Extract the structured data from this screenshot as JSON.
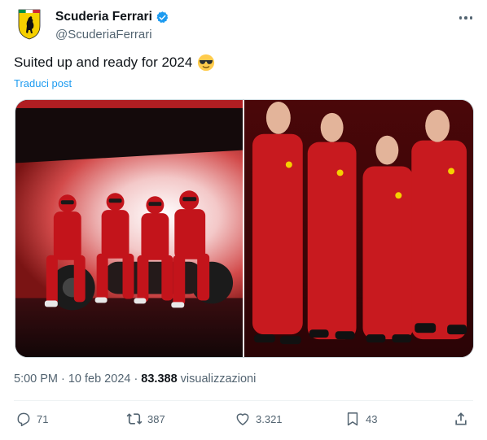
{
  "author": {
    "display_name": "Scuderia Ferrari",
    "handle": "@ScuderiaFerrari",
    "verified": true,
    "avatar_icon": "ferrari-shield-logo"
  },
  "tweet": {
    "text": "Suited up and ready for 2024",
    "emoji": "smiling-face-with-sunglasses",
    "translate_label": "Traduci post"
  },
  "meta": {
    "time": "5:00 PM",
    "date": "10 feb 2024",
    "separator": "·",
    "views_count": "83.388",
    "views_label": "visualizzazioni"
  },
  "actions": {
    "replies": "71",
    "reposts": "387",
    "likes": "3.321",
    "bookmarks": "43"
  },
  "colors": {
    "accent": "#1d9bf0",
    "text_primary": "#0f1419",
    "text_secondary": "#536471",
    "ferrari_red": "#c8102e",
    "ferrari_yellow": "#f5d000"
  }
}
